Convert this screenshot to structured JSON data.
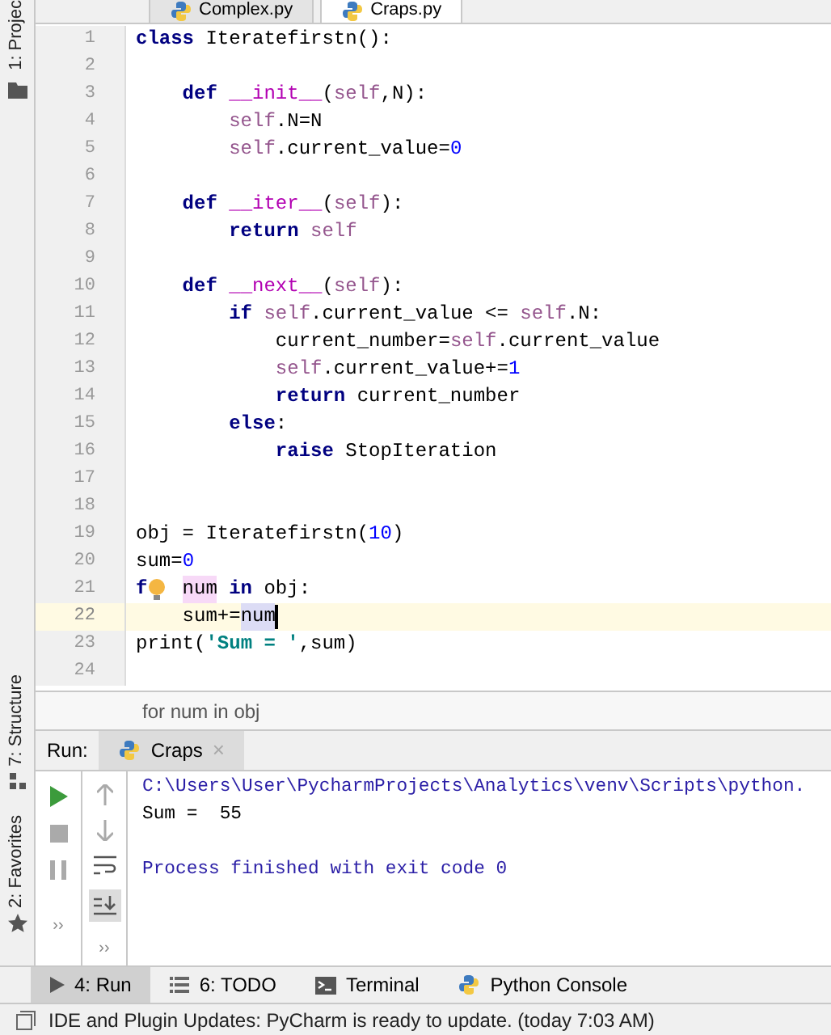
{
  "editor_tabs": [
    {
      "label": "Complex.py",
      "selected": false
    },
    {
      "label": "Craps.py",
      "selected": true
    }
  ],
  "left_strip": [
    {
      "label": "1: Projec"
    },
    {
      "label": "7: Structure"
    },
    {
      "label": "2: Favorites"
    }
  ],
  "code_lines": [
    {
      "number": "1",
      "current": false,
      "tokens": [
        {
          "kind": "keyword",
          "text": "class"
        },
        {
          "kind": "plain",
          "text": " Iteratefirstn():"
        }
      ]
    },
    {
      "number": "2",
      "current": false
    },
    {
      "number": "3",
      "current": false,
      "tokens": [
        {
          "kind": "keyword",
          "text": "    def"
        },
        {
          "kind": "magic",
          "text": " __init__"
        },
        {
          "kind": "plain",
          "text": "("
        },
        {
          "kind": "self",
          "text": "self"
        },
        {
          "kind": "plain",
          "text": ",N):"
        }
      ]
    },
    {
      "number": "4",
      "current": false,
      "tokens": [
        {
          "kind": "self",
          "text": "        self"
        },
        {
          "kind": "plain",
          "text": ".N=N"
        }
      ]
    },
    {
      "number": "5",
      "current": false,
      "tokens": [
        {
          "kind": "self",
          "text": "        self"
        },
        {
          "kind": "plain",
          "text": ".current_value="
        },
        {
          "kind": "number",
          "text": "0"
        }
      ]
    },
    {
      "number": "6",
      "current": false
    },
    {
      "number": "7",
      "current": false,
      "tokens": [
        {
          "kind": "keyword",
          "text": "    def"
        },
        {
          "kind": "magic",
          "text": " __iter__"
        },
        {
          "kind": "plain",
          "text": "("
        },
        {
          "kind": "self",
          "text": "self"
        },
        {
          "kind": "plain",
          "text": "):"
        }
      ]
    },
    {
      "number": "8",
      "current": false,
      "tokens": [
        {
          "kind": "keyword",
          "text": "        return"
        },
        {
          "kind": "self",
          "text": " self"
        }
      ]
    },
    {
      "number": "9",
      "current": false
    },
    {
      "number": "10",
      "current": false,
      "tokens": [
        {
          "kind": "keyword",
          "text": "    def"
        },
        {
          "kind": "magic",
          "text": " __next__"
        },
        {
          "kind": "plain",
          "text": "("
        },
        {
          "kind": "self",
          "text": "self"
        },
        {
          "kind": "plain",
          "text": "):"
        }
      ]
    },
    {
      "number": "11",
      "current": false,
      "tokens": [
        {
          "kind": "keyword",
          "text": "        if"
        },
        {
          "kind": "self",
          "text": " self"
        },
        {
          "kind": "plain",
          "text": ".current_value <= "
        },
        {
          "kind": "self",
          "text": "self"
        },
        {
          "kind": "plain",
          "text": ".N:"
        }
      ]
    },
    {
      "number": "12",
      "current": false,
      "tokens": [
        {
          "kind": "plain",
          "text": "            current_number="
        },
        {
          "kind": "self",
          "text": "self"
        },
        {
          "kind": "plain",
          "text": ".current_value"
        }
      ]
    },
    {
      "number": "13",
      "current": false,
      "tokens": [
        {
          "kind": "self",
          "text": "            self"
        },
        {
          "kind": "plain",
          "text": ".current_value+="
        },
        {
          "kind": "number",
          "text": "1"
        }
      ]
    },
    {
      "number": "14",
      "current": false,
      "tokens": [
        {
          "kind": "keyword",
          "text": "            return"
        },
        {
          "kind": "plain",
          "text": " current_number"
        }
      ]
    },
    {
      "number": "15",
      "current": false,
      "tokens": [
        {
          "kind": "keyword",
          "text": "        else"
        },
        {
          "kind": "plain",
          "text": ":"
        }
      ]
    },
    {
      "number": "16",
      "current": false,
      "tokens": [
        {
          "kind": "keyword",
          "text": "            raise"
        },
        {
          "kind": "plain",
          "text": " StopIteration"
        }
      ]
    },
    {
      "number": "17",
      "current": false
    },
    {
      "number": "18",
      "current": false
    },
    {
      "number": "19",
      "current": false,
      "tokens": [
        {
          "kind": "plain",
          "text": "obj = Iteratefirstn("
        },
        {
          "kind": "number",
          "text": "10"
        },
        {
          "kind": "plain",
          "text": ")"
        }
      ]
    },
    {
      "number": "20",
      "current": false,
      "tokens": [
        {
          "kind": "plain",
          "text": "sum="
        },
        {
          "kind": "number",
          "text": "0"
        }
      ]
    },
    {
      "number": "21",
      "current": false,
      "bulb": true,
      "tokens": [
        {
          "kind": "keyword",
          "text": "f"
        },
        {
          "kind": "usage",
          "text": "num"
        },
        {
          "kind": "keyword",
          "text": " in"
        },
        {
          "kind": "plain",
          "text": " obj:"
        }
      ]
    },
    {
      "number": "22",
      "current": true,
      "tokens": [
        {
          "kind": "plain",
          "text": "    sum+="
        },
        {
          "kind": "write-usage",
          "text": "num"
        }
      ]
    },
    {
      "number": "23",
      "current": false,
      "tokens": [
        {
          "kind": "plain",
          "text": "print("
        },
        {
          "kind": "string",
          "text": "'Sum = '"
        },
        {
          "kind": "plain",
          "text": ",sum)"
        }
      ]
    },
    {
      "number": "24",
      "current": false
    }
  ],
  "breadcrumb": "for num in obj",
  "run_panel": {
    "label": "Run:",
    "tabs": [
      {
        "label": "Craps",
        "selected": true,
        "close": "×"
      }
    ],
    "output": [
      {
        "kind": "command",
        "text": "C:\\Users\\User\\PycharmProjects\\Analytics\\venv\\Scripts\\python."
      },
      {
        "kind": "stdout",
        "text": "Sum =  55"
      },
      {
        "kind": "blank"
      },
      {
        "kind": "system",
        "text": "Process finished with exit code 0"
      }
    ],
    "more": [
      "››",
      "››"
    ]
  },
  "tool_windows": [
    {
      "label": "4: Run",
      "kind": "run",
      "selected": true
    },
    {
      "label": "6: TODO",
      "kind": "todo",
      "selected": false
    },
    {
      "label": "Terminal",
      "kind": "terminal",
      "selected": false
    },
    {
      "label": "Python Console",
      "kind": "python",
      "selected": false
    }
  ],
  "status_bar": "IDE and Plugin Updates: PyCharm is ready to update. (today 7:03 AM)"
}
